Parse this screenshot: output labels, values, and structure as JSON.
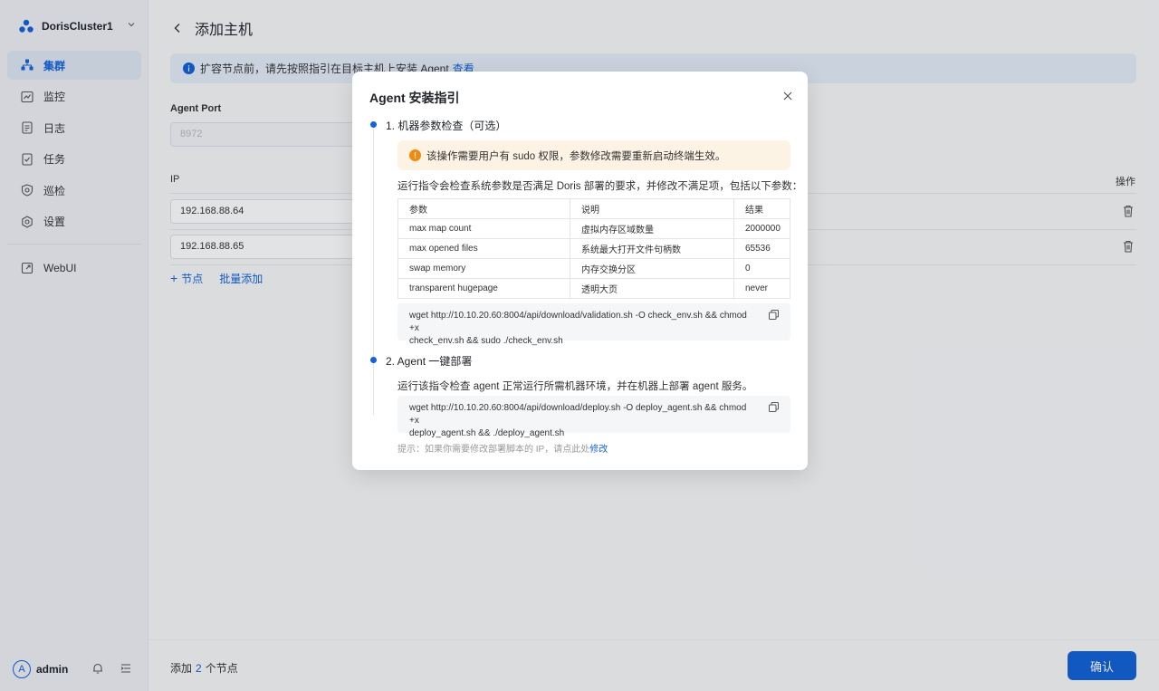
{
  "sidebar": {
    "cluster_name": "DorisCluster1",
    "items": [
      {
        "label": "集群",
        "icon": "cluster-icon",
        "active": true
      },
      {
        "label": "监控",
        "icon": "monitor-icon"
      },
      {
        "label": "日志",
        "icon": "log-icon"
      },
      {
        "label": "任务",
        "icon": "task-icon"
      },
      {
        "label": "巡检",
        "icon": "inspect-icon"
      },
      {
        "label": "设置",
        "icon": "gear-icon"
      }
    ],
    "external": {
      "label": "WebUI",
      "icon": "external-link-icon"
    },
    "user": {
      "avatar": "A",
      "name": "admin"
    }
  },
  "main": {
    "title": "添加主机",
    "alert": {
      "text": "扩容节点前，请先按照指引在目标主机上安装 Agent",
      "link": "查看"
    },
    "agent_port": {
      "label": "Agent Port",
      "placeholder": "8972"
    },
    "table": {
      "ip_header": "IP",
      "op_header": "操作",
      "rows": [
        {
          "ip": "192.168.88.64"
        },
        {
          "ip": "192.168.88.65"
        }
      ]
    },
    "add_node": "节点",
    "batch_add": "批量添加",
    "footer": {
      "prefix": "添加",
      "count": "2",
      "suffix": "个节点",
      "confirm": "确认"
    }
  },
  "modal": {
    "title": "Agent 安装指引",
    "step1": {
      "title": "1. 机器参数检查（可选）",
      "warning": "该操作需要用户有 sudo 权限，参数修改需要重新启动终端生效。",
      "desc": "运行指令会检查系统参数是否满足 Doris 部署的要求，并修改不满足项，包括以下参数：",
      "headers": [
        "参数",
        "说明",
        "结果"
      ],
      "rows": [
        [
          "max map count",
          "虚拟内存区域数量",
          "2000000"
        ],
        [
          "max opened files",
          "系统最大打开文件句柄数",
          "65536"
        ],
        [
          "swap memory",
          "内存交换分区",
          "0"
        ],
        [
          "transparent hugepage",
          "透明大页",
          "never"
        ]
      ],
      "command_line1": "wget http://10.10.20.60:8004/api/download/validation.sh -O check_env.sh && chmod +x",
      "command_line2": "check_env.sh && sudo ./check_env.sh"
    },
    "step2": {
      "title": "2. Agent 一键部署",
      "desc": "运行该指令检查 agent 正常运行所需机器环境，并在机器上部署 agent 服务。",
      "command_line1": "wget http://10.10.20.60:8004/api/download/deploy.sh -O deploy_agent.sh && chmod +x",
      "command_line2": "deploy_agent.sh && ./deploy_agent.sh"
    },
    "hint": {
      "text": "提示：如果你需要修改部署脚本的 IP，请点此处",
      "link": "修改"
    }
  }
}
